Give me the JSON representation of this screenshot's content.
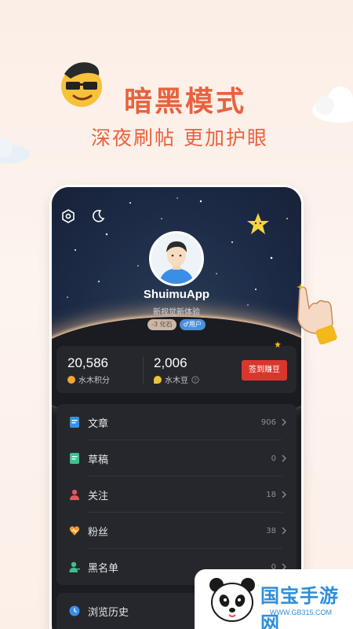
{
  "promo": {
    "title": "暗黑模式",
    "subtitle": "深夜刷帖 更加护眼"
  },
  "profile": {
    "username": "ShuimuApp",
    "tagline": "新视觉新体验",
    "badge_level": "-3 化石",
    "badge_role": "♂用户"
  },
  "stats": {
    "points_value": "20,586",
    "points_label": "水木积分",
    "beans_value": "2,006",
    "beans_label": "水木豆",
    "checkin_label": "签到赚豆"
  },
  "menu": {
    "items": [
      {
        "label": "文章",
        "count": "906",
        "icon": "article-icon",
        "color": "#3b8ee6"
      },
      {
        "label": "草稿",
        "count": "0",
        "icon": "draft-icon",
        "color": "#3fbf8f"
      },
      {
        "label": "关注",
        "count": "18",
        "icon": "follow-icon",
        "color": "#e8565a"
      },
      {
        "label": "粉丝",
        "count": "38",
        "icon": "fans-icon",
        "color": "#f09a2e"
      },
      {
        "label": "黑名单",
        "count": "0",
        "icon": "blacklist-icon",
        "color": "#3fbf8f"
      }
    ],
    "history_label": "浏览历史"
  },
  "watermark": {
    "title": "国宝手游网",
    "url": "WWW.GB315.COM"
  },
  "colors": {
    "accent": "#e8623f",
    "checkin": "#d9372e",
    "watermark": "#2e8ed9"
  }
}
